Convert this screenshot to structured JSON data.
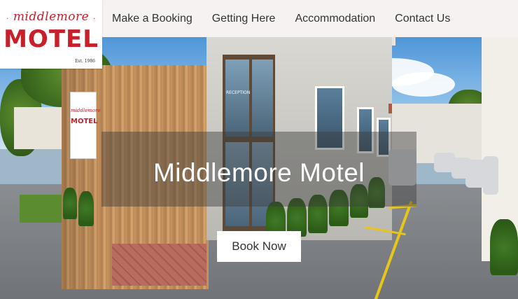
{
  "logo": {
    "script_text": "middlemore",
    "main_text": "MOTEL",
    "est_text": "Est. 1986",
    "brand_color": "#c8202b"
  },
  "nav": {
    "items": [
      {
        "label": "Make a Booking"
      },
      {
        "label": "Getting Here"
      },
      {
        "label": "Accommodation"
      },
      {
        "label": "Contact Us"
      }
    ]
  },
  "hero": {
    "title": "Middlemore Motel",
    "button_label": "Book Now",
    "sign_script": "middlemore",
    "sign_main": "MOTEL",
    "reception_label": "RECEPTION"
  },
  "colors": {
    "header_bg": "#f6f2f2",
    "nav_text": "#333333",
    "overlay": "rgba(60,60,60,0.45)"
  }
}
